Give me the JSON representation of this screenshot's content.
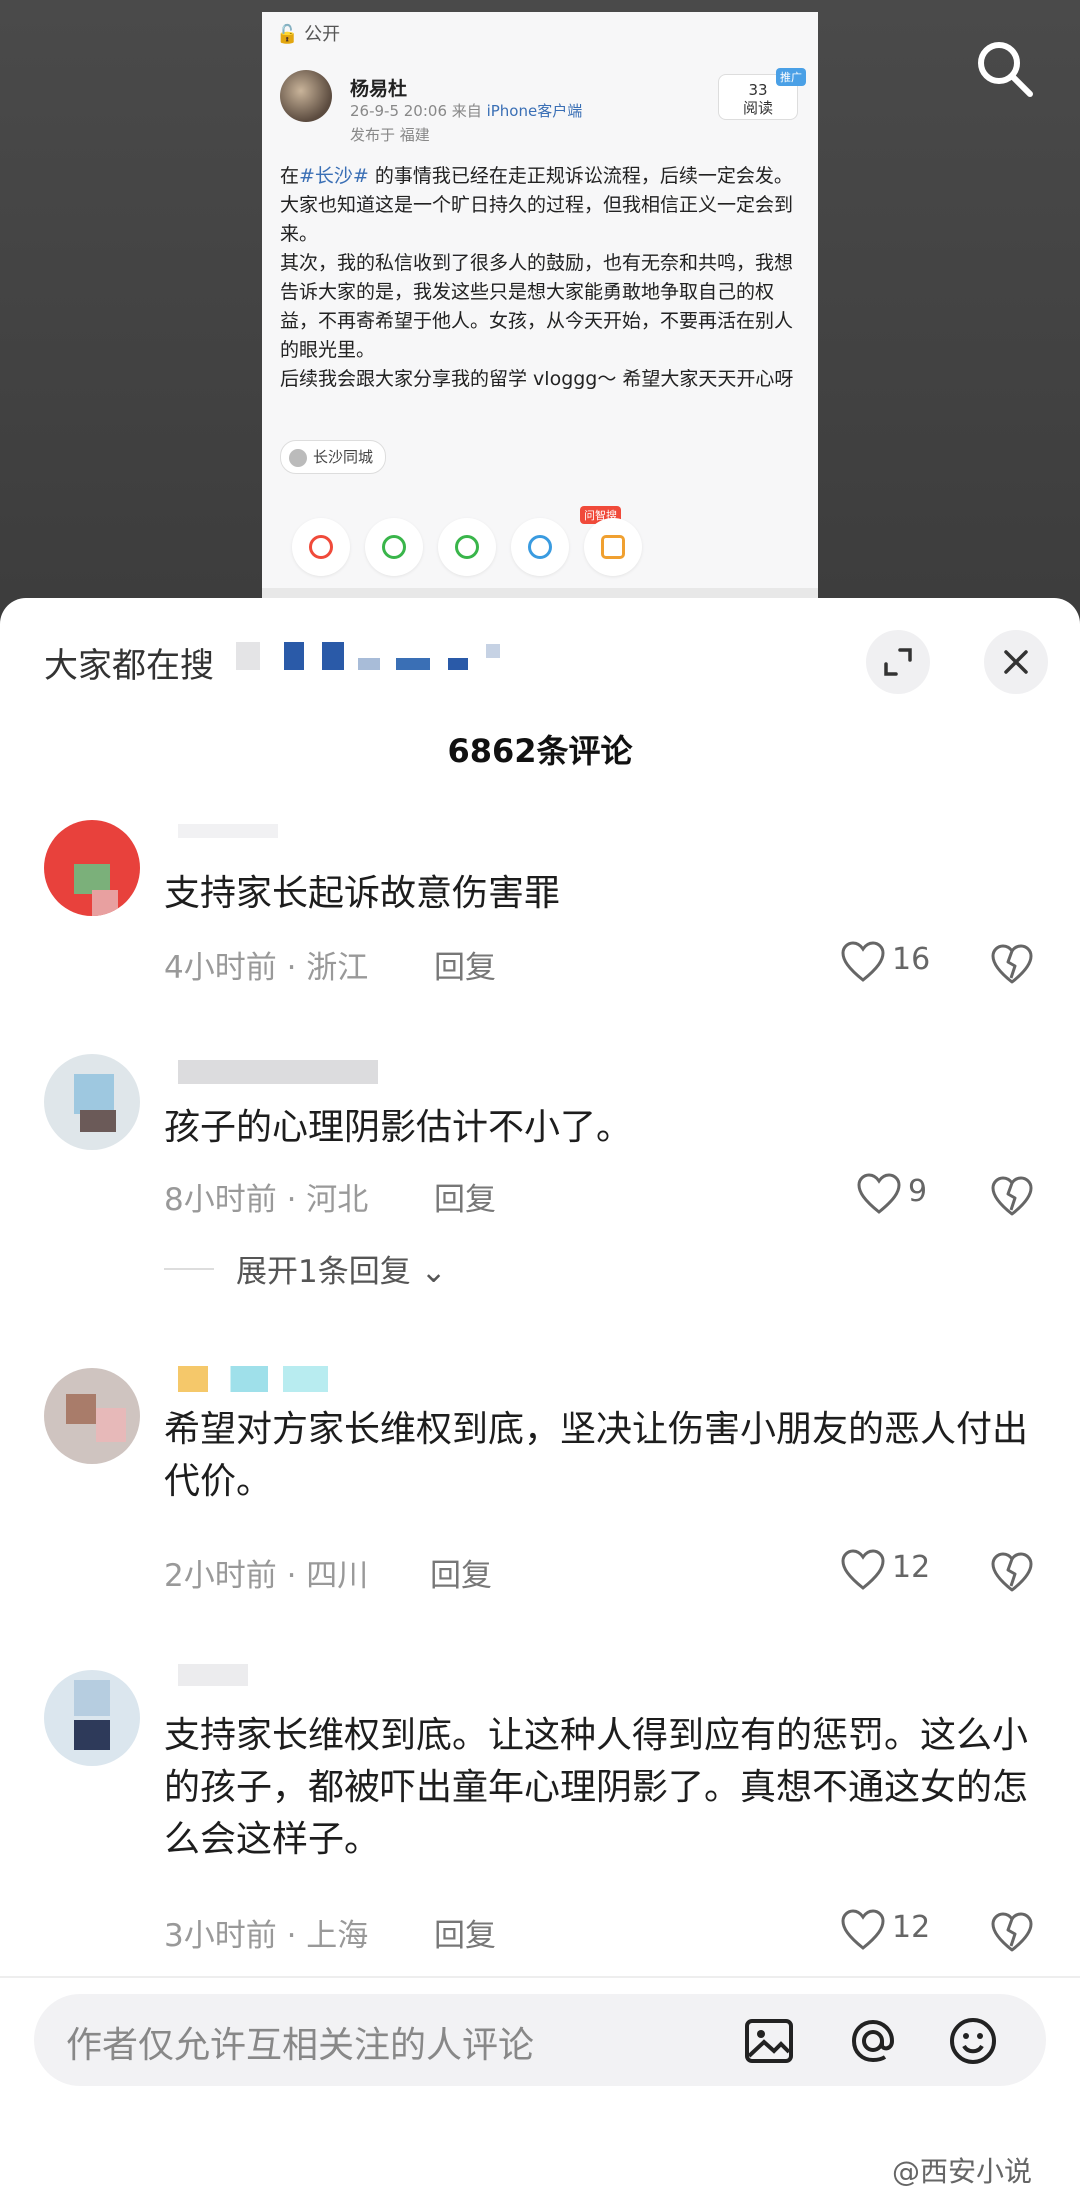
{
  "post": {
    "visibility": "公开",
    "user": "杨易杜",
    "time": "26-9-5 20:06",
    "source_prefix": "来自",
    "source": "iPhone客户端",
    "location": "发布于 福建",
    "reads_count": "33",
    "reads_label": "阅读",
    "promo": "推广",
    "body_pre": "在",
    "tag": "#长沙#",
    "body_post": " 的事情我已经在走正规诉讼流程，后续一定会发。大家也知道这是一个旷日持久的过程，但我相信正义一定会到来。\n其次，我的私信收到了很多人的鼓励，也有无奈和共鸣，我想告诉大家的是，我发这些只是想大家能勇敢地争取自己的权益，不再寄希望于他人。女孩，从今天开始，不要再活在别人的眼光里。\n后续我会跟大家分享我的留学 vloggg～ 希望大家天天开心呀",
    "topic": "长沙同城",
    "share_badge": "问智搜"
  },
  "sheet": {
    "title": "大家都在搜",
    "count": "6862条评论"
  },
  "comments": [
    {
      "text": "支持家长起诉故意伤害罪",
      "time_loc": "4小时前 · 浙江",
      "reply": "回复",
      "likes": "16"
    },
    {
      "text": "孩子的心理阴影估计不小了。",
      "time_loc": "8小时前 · 河北",
      "reply": "回复",
      "likes": "9"
    },
    {
      "text": "希望对方家长维权到底，坚决让伤害小朋友的恶人付出代价。",
      "time_loc": "2小时前 · 四川",
      "reply": "回复",
      "likes": "12"
    },
    {
      "text": "支持家长维权到底。让这种人得到应有的惩罚。这么小的孩子，都被吓出童年心理阴影了。真想不通这女的怎么会这样子。",
      "time_loc": "3小时前 · 上海",
      "reply": "回复",
      "likes": "12"
    }
  ],
  "expand_replies": "展开1条回复",
  "input": {
    "placeholder": "作者仅允许互相关注的人评论"
  },
  "watermark": "@西安小说",
  "colors": {
    "link": "#3a6fb5",
    "sheet_bg": "#ffffff",
    "backdrop": "#3a3a3a"
  }
}
